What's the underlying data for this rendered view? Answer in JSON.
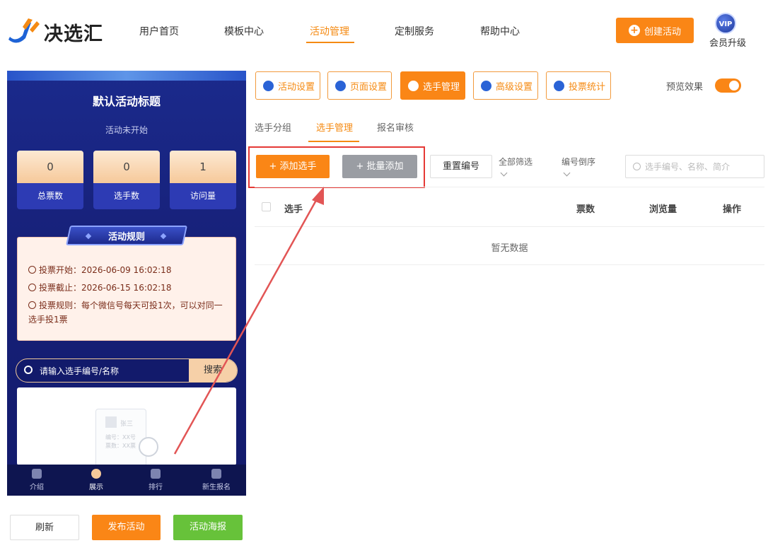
{
  "brand": {
    "name": "决选汇"
  },
  "nav": {
    "items": [
      {
        "label": "用户首页"
      },
      {
        "label": "模板中心"
      },
      {
        "label": "活动管理"
      },
      {
        "label": "定制服务"
      },
      {
        "label": "帮助中心"
      }
    ],
    "active_index": 2,
    "create_label": "创建活动",
    "vip_badge": "VIP",
    "upgrade_label": "会员升级"
  },
  "colors": {
    "accent": "#fa8616",
    "primary_dark": "#1b2a8c",
    "highlight": "#e53935",
    "success": "#67c23a"
  },
  "preview": {
    "title": "默认活动标题",
    "status": "活动未开始",
    "stats": [
      {
        "value": "0",
        "label": "总票数"
      },
      {
        "value": "0",
        "label": "选手数"
      },
      {
        "value": "1",
        "label": "访问量"
      }
    ],
    "rules_title": "活动规则",
    "rules": [
      {
        "icon": "clock-icon",
        "text": "投票开始：2026-06-09 16:02:18"
      },
      {
        "icon": "clock-icon",
        "text": "投票截止：2026-06-15 16:02:18"
      },
      {
        "icon": "info-icon",
        "text": "投票规则：每个微信号每天可投1次，可以对同一选手投1票"
      }
    ],
    "search_placeholder": "请输入选手编号/名称",
    "search_button": "搜索",
    "empty_illustration": {
      "name": "张三",
      "line1": "编号：XX号",
      "line2": "票数：XX票"
    },
    "tabs": [
      {
        "label": "介绍",
        "icon": "intro-icon"
      },
      {
        "label": "展示",
        "icon": "display-icon"
      },
      {
        "label": "排行",
        "icon": "rank-icon"
      },
      {
        "label": "新生报名",
        "icon": "signup-icon"
      }
    ],
    "active_tab": 1
  },
  "bottom_buttons": {
    "refresh": "刷新",
    "publish": "发布活动",
    "poster": "活动海报"
  },
  "settings_tabs": [
    {
      "label": "活动设置",
      "icon": "star-icon"
    },
    {
      "label": "页面设置",
      "icon": "gear-icon"
    },
    {
      "label": "选手管理",
      "icon": "users-icon"
    },
    {
      "label": "高级设置",
      "icon": "advanced-icon"
    },
    {
      "label": "投票统计",
      "icon": "chart-icon"
    }
  ],
  "active_settings_tab": 2,
  "preview_toggle": {
    "label": "预览效果",
    "on": true
  },
  "sub_tabs": [
    {
      "label": "选手分组"
    },
    {
      "label": "选手管理"
    },
    {
      "label": "报名审核"
    }
  ],
  "active_sub_tab": 1,
  "toolbar": {
    "add_label": "添加选手",
    "batch_label": "批量添加",
    "reset_label": "重置编号",
    "filter_label": "全部筛选",
    "sort_label": "编号倒序",
    "search_placeholder": "选手编号、名称、简介"
  },
  "table": {
    "columns": [
      "选手",
      "票数",
      "浏览量",
      "操作"
    ],
    "rows": [],
    "empty_text": "暂无数据"
  }
}
